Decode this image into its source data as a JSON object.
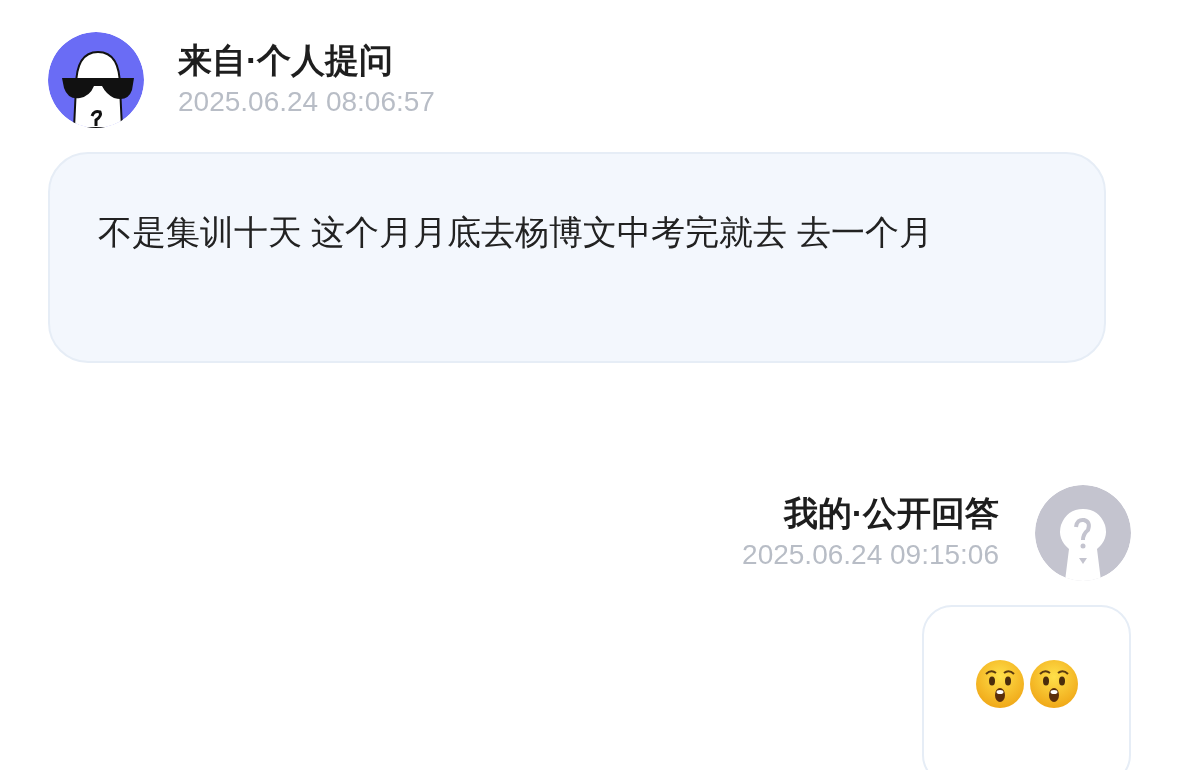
{
  "question": {
    "author": "来自·个人提问",
    "time": "2025.06.24 08:06:57",
    "text": "不是集训十天 这个月月底去杨博文中考完就去 去一个月"
  },
  "answer": {
    "author": "我的·公开回答",
    "time": "2025.06.24 09:15:06",
    "content": [
      {
        "kind": "emoji"
      },
      {
        "kind": "emoji"
      }
    ]
  }
}
